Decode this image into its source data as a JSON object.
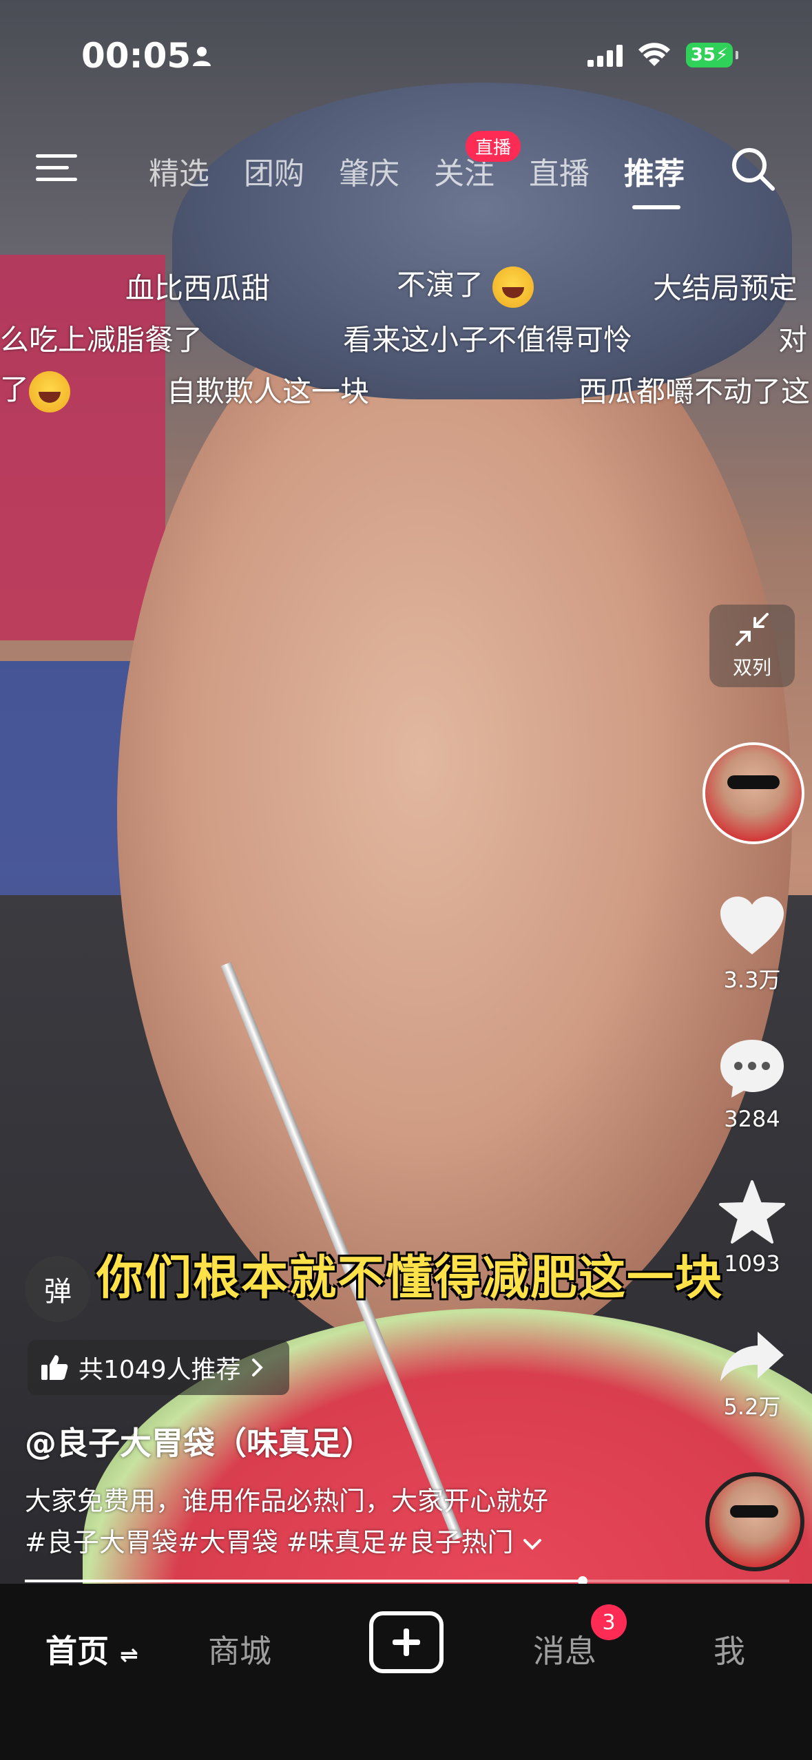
{
  "status_bar": {
    "time": "00:05",
    "battery": "35"
  },
  "top_nav": {
    "tabs": [
      {
        "label": "精选"
      },
      {
        "label": "团购"
      },
      {
        "label": "肇庆"
      },
      {
        "label": "关注"
      },
      {
        "label": "直播"
      },
      {
        "label": "推荐"
      }
    ],
    "active_tab": "推荐",
    "live_badge": "直播"
  },
  "danmaku": [
    "血比西瓜甜",
    "不演了",
    "大结局预定",
    "么吃上减脂餐了",
    "看来这小子不值得可怜",
    "对",
    "了",
    "自欺欺人这一块",
    "西瓜都嚼不动了这"
  ],
  "side_actions": {
    "dual_column": "双列",
    "likes": "3.3万",
    "comments": "3284",
    "favorites": "1093",
    "shares": "5.2万"
  },
  "video": {
    "subtitle": "你们根本就不懂得减肥这一块",
    "danmu_toggle": "弹",
    "recommend_count": "共1049人推荐",
    "author": "@良子大胃袋（味真足）",
    "description": "大家免费用，谁用作品必热门，大家开心就好",
    "hashtags": "#良子大胃袋#大胃袋 #味真足#良子热门",
    "progress": 0.73
  },
  "bottom_nav": {
    "home": "首页",
    "mall": "商城",
    "messages": "消息",
    "messages_badge": "3",
    "me": "我"
  }
}
